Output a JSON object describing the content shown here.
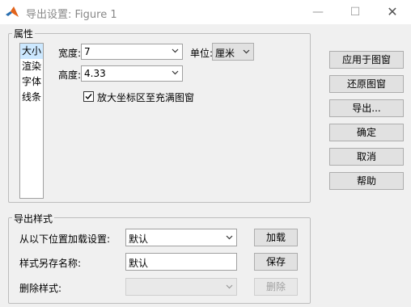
{
  "window": {
    "title": "导出设置: Figure 1",
    "controls": {
      "minimize": "—",
      "maximize": "☐",
      "close": "✕"
    }
  },
  "properties": {
    "group_label": "属性",
    "categories": [
      "大小",
      "渲染",
      "字体",
      "线条"
    ],
    "selected_category": "大小",
    "width_label": "宽度:",
    "width_value": "7",
    "height_label": "高度:",
    "height_value": "4.33",
    "units_label": "单位:",
    "units_value": "厘米",
    "expand_axes_label": "放大坐标区至充满图窗",
    "expand_axes_checked": true
  },
  "side_buttons": {
    "apply": "应用于图窗",
    "revert": "还原图窗",
    "export": "导出...",
    "ok": "确定",
    "cancel": "取消",
    "help": "帮助"
  },
  "export_styles": {
    "group_label": "导出样式",
    "load_label": "从以下位置加载设置:",
    "load_value": "默认",
    "load_button": "加载",
    "save_label": "样式另存名称:",
    "save_value": "默认",
    "save_button": "保存",
    "delete_label": "删除样式:",
    "delete_value": "",
    "delete_button": "删除"
  }
}
